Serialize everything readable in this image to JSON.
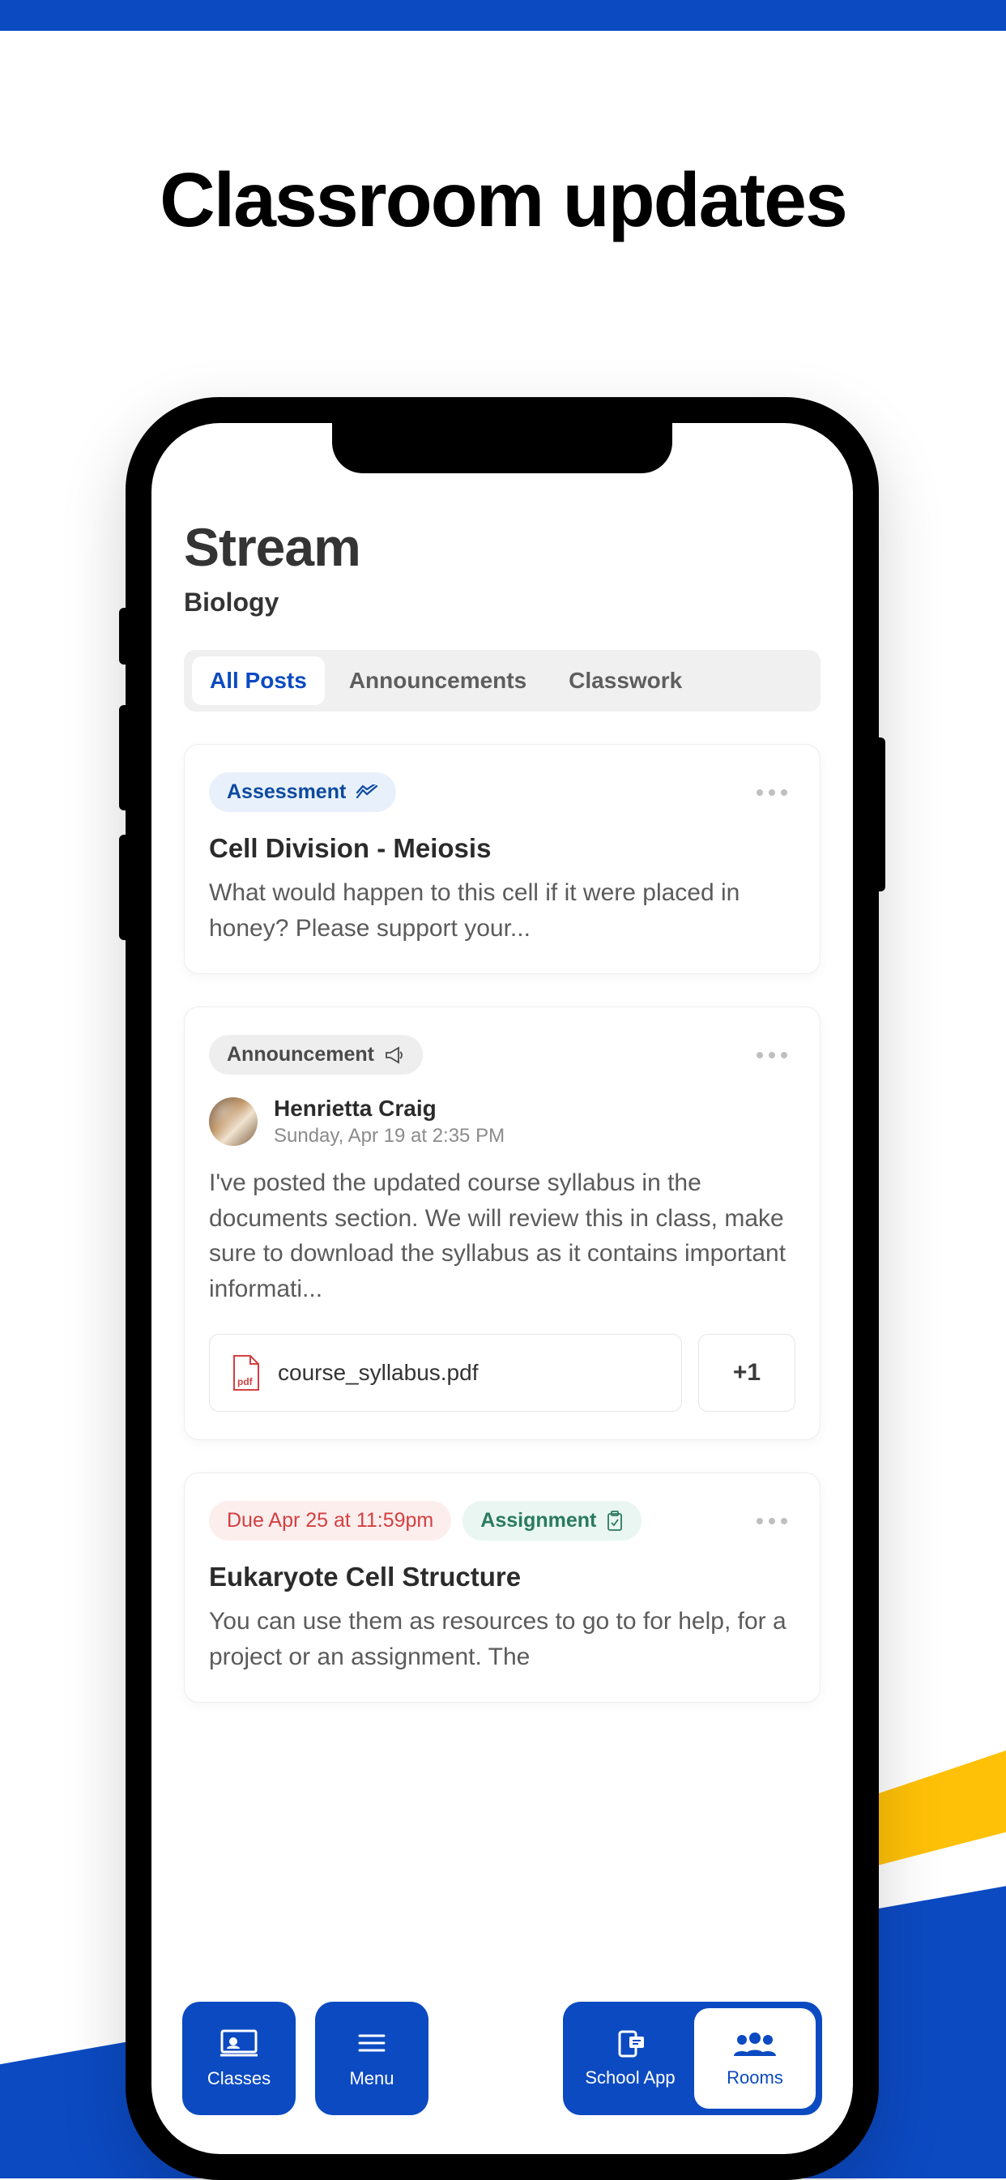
{
  "promo": {
    "title": "Classroom updates"
  },
  "header": {
    "title": "Stream",
    "subject": "Biology"
  },
  "tabs": [
    "All Posts",
    "Announcements",
    "Classwork"
  ],
  "cards": {
    "assessment": {
      "badge": "Assessment",
      "title": "Cell Division - Meiosis",
      "desc": "What would happen to this cell if it were placed in honey? Please support your..."
    },
    "announcement": {
      "badge": "Announcement",
      "author": "Henrietta Craig",
      "date": "Sunday, Apr 19 at 2:35 PM",
      "desc": "I've posted the updated course syllabus in the documents section. We will review this in class, make sure to download the syllabus as it contains important informati...",
      "attachment_name": "course_syllabus.pdf",
      "attachment_more": "+1",
      "pdf_label": "pdf"
    },
    "assignment": {
      "due": "Due Apr 25 at 11:59pm",
      "badge": "Assignment",
      "title": "Eukaryote Cell Structure",
      "desc": "You can use them as resources to go to for help, for a project or an assignment. The"
    }
  },
  "nav": {
    "classes": "Classes",
    "menu": "Menu",
    "school_app": "School App",
    "rooms": "Rooms"
  }
}
